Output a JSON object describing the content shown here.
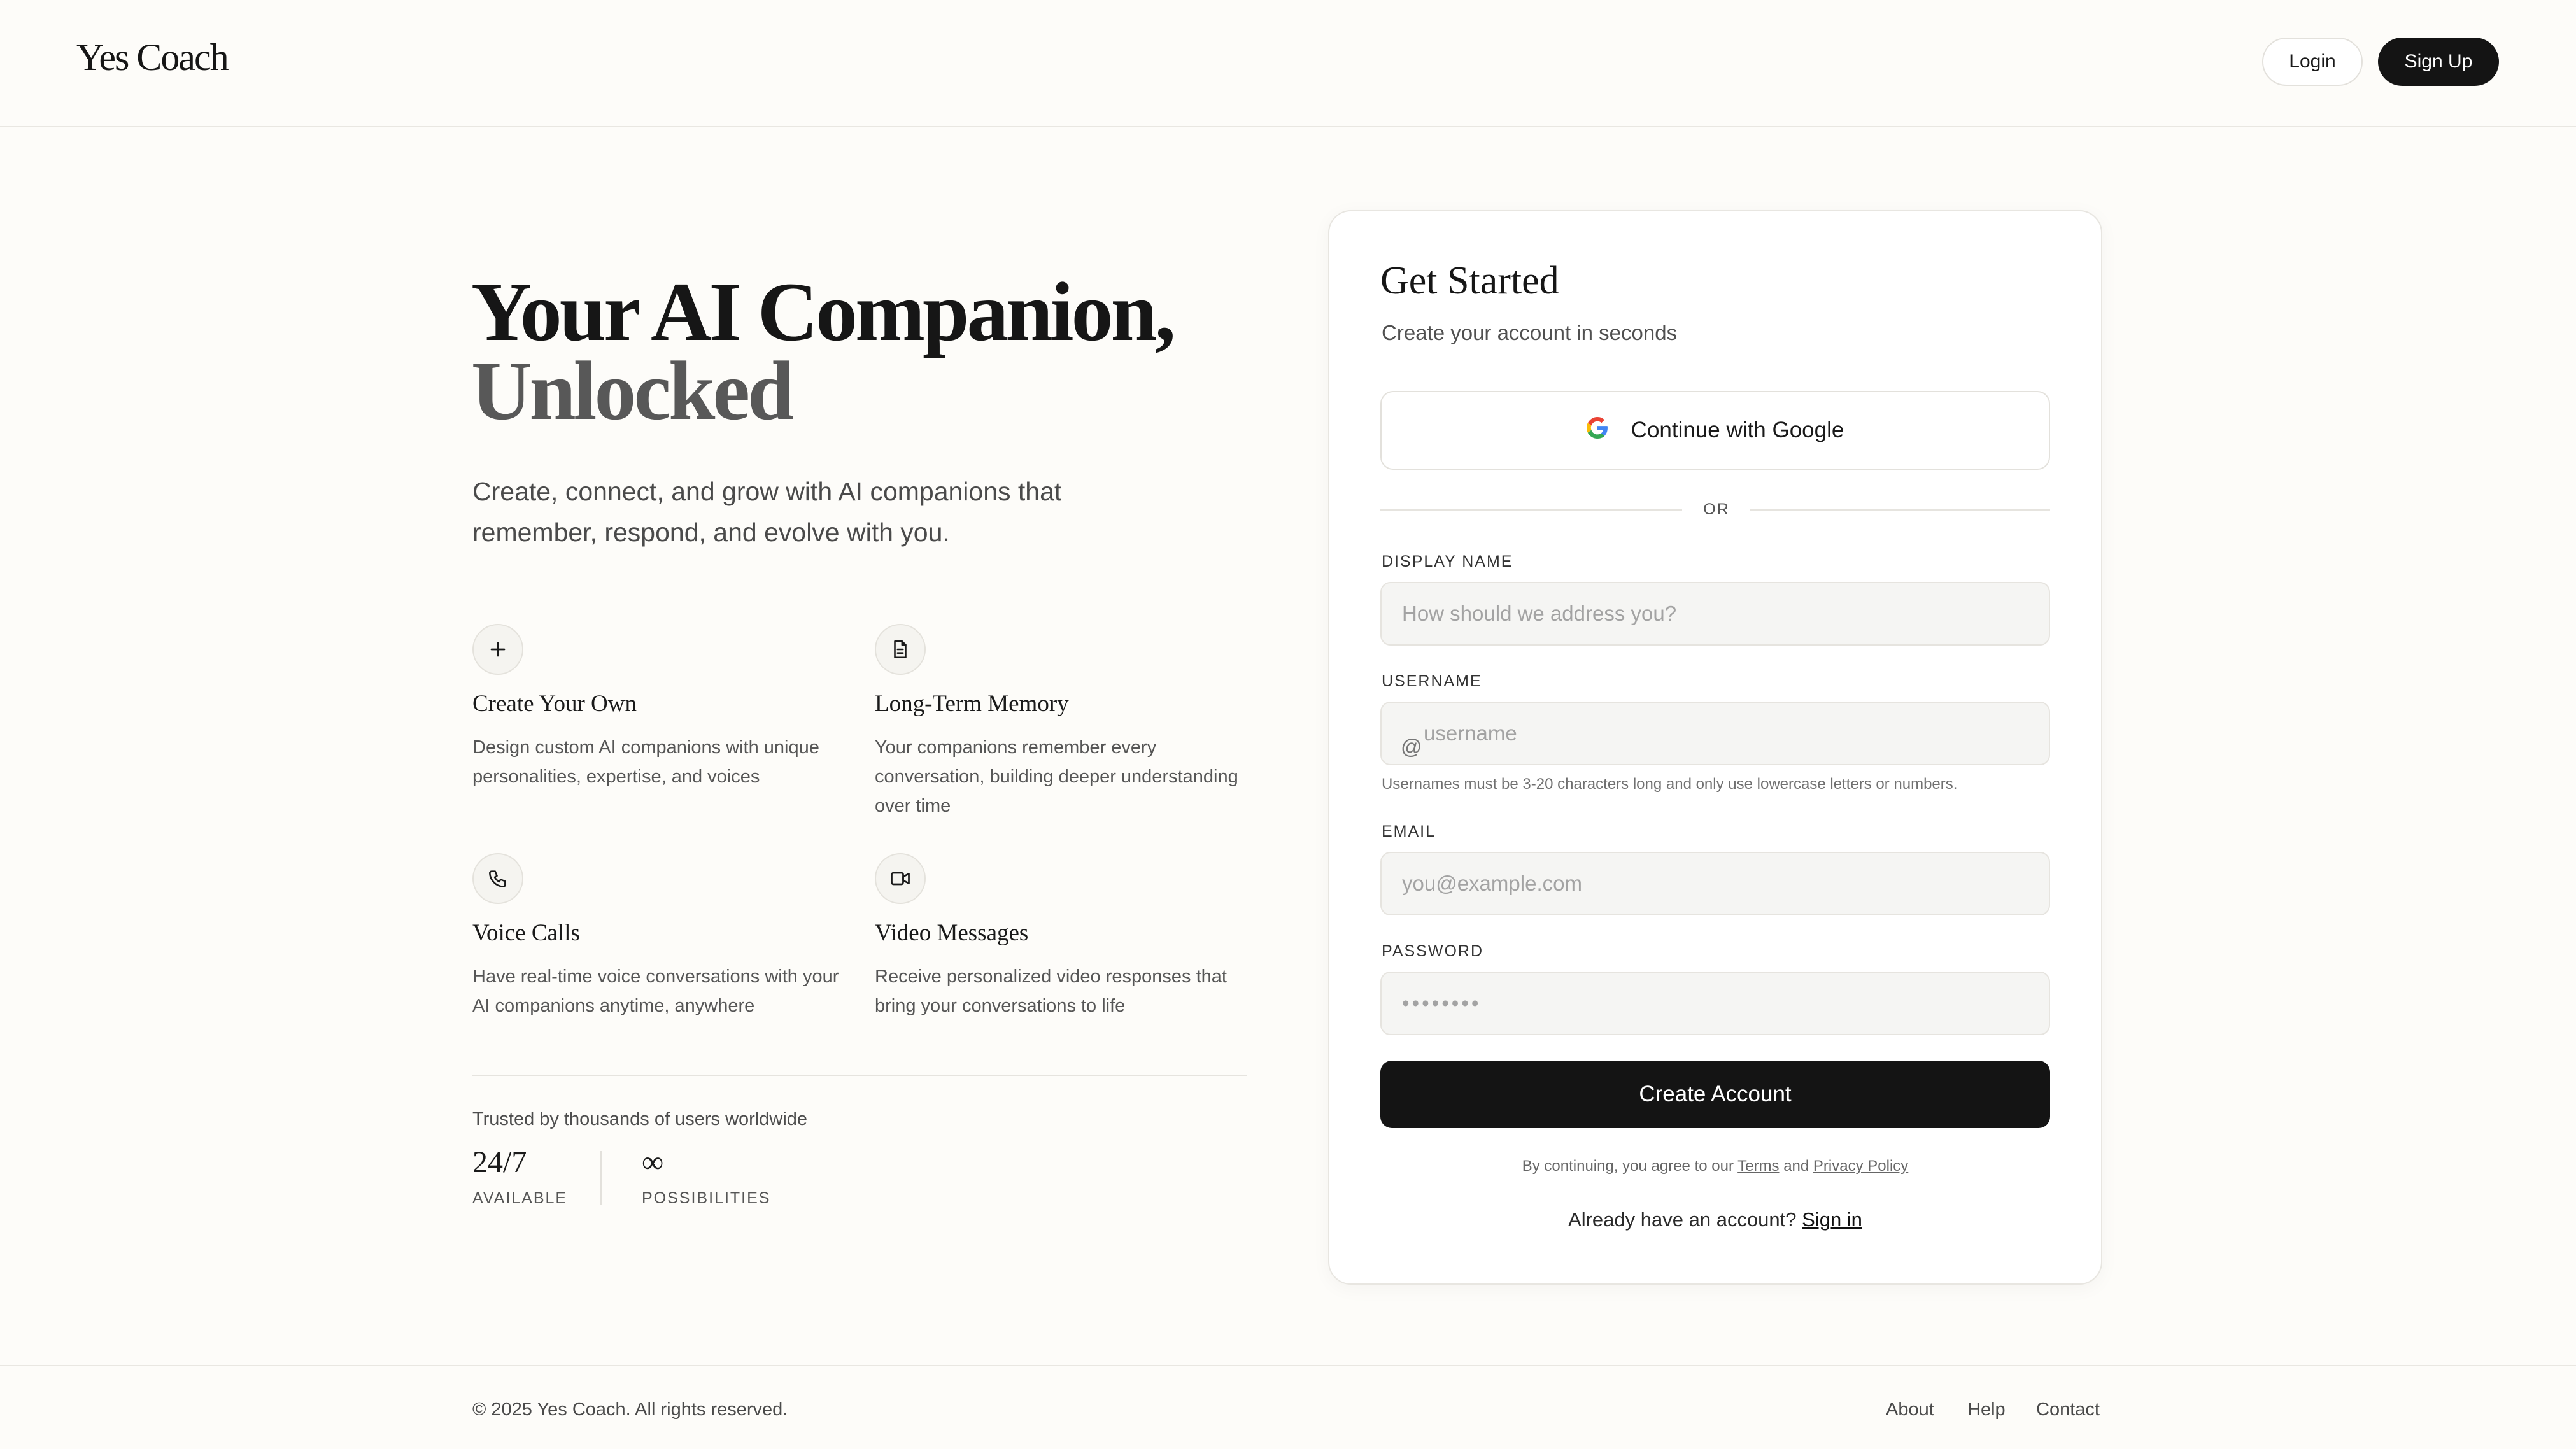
{
  "header": {
    "logo": "Yes Coach",
    "login_label": "Login",
    "signup_label": "Sign Up"
  },
  "hero": {
    "title_line1": "Your AI Companion,",
    "title_line2": "Unlocked",
    "subtitle": "Create, connect, and grow with AI companions that remember, respond, and evolve with you."
  },
  "features": [
    {
      "icon": "plus-icon",
      "title": "Create Your Own",
      "description": "Design custom AI companions with unique personalities, expertise, and voices"
    },
    {
      "icon": "document-icon",
      "title": "Long-Term Memory",
      "description": "Your companions remember every conversation, building deeper understanding over time"
    },
    {
      "icon": "phone-icon",
      "title": "Voice Calls",
      "description": "Have real-time voice conversations with your AI companions anytime, anywhere"
    },
    {
      "icon": "video-icon",
      "title": "Video Messages",
      "description": "Receive personalized video responses that bring your conversations to life"
    }
  ],
  "trust": {
    "text": "Trusted by thousands of users worldwide",
    "stats": [
      {
        "value": "24/7",
        "label": "AVAILABLE"
      },
      {
        "value": "∞",
        "label": "POSSIBILITIES"
      }
    ]
  },
  "signup_card": {
    "title": "Get Started",
    "subtitle": "Create your account in seconds",
    "google_label": "Continue with Google",
    "or_label": "OR",
    "display_name": {
      "label": "DISPLAY NAME",
      "placeholder": "How should we address you?",
      "value": ""
    },
    "username": {
      "label": "USERNAME",
      "prefix": "@",
      "placeholder": "username",
      "value": "",
      "hint": "Usernames must be 3-20 characters long and only use lowercase letters or numbers."
    },
    "email": {
      "label": "EMAIL",
      "placeholder": "you@example.com",
      "value": ""
    },
    "password": {
      "label": "PASSWORD",
      "placeholder": "••••••••",
      "value": ""
    },
    "create_label": "Create Account",
    "terms_prefix": "By continuing, you agree to our",
    "terms_link": "Terms",
    "terms_and": "and",
    "privacy_link": "Privacy Policy",
    "signin_prompt": "Already have an account?",
    "signin_link": "Sign in"
  },
  "footer": {
    "copyright": "© 2025 Yes Coach. All rights reserved.",
    "links": [
      "About",
      "Help",
      "Contact"
    ]
  }
}
